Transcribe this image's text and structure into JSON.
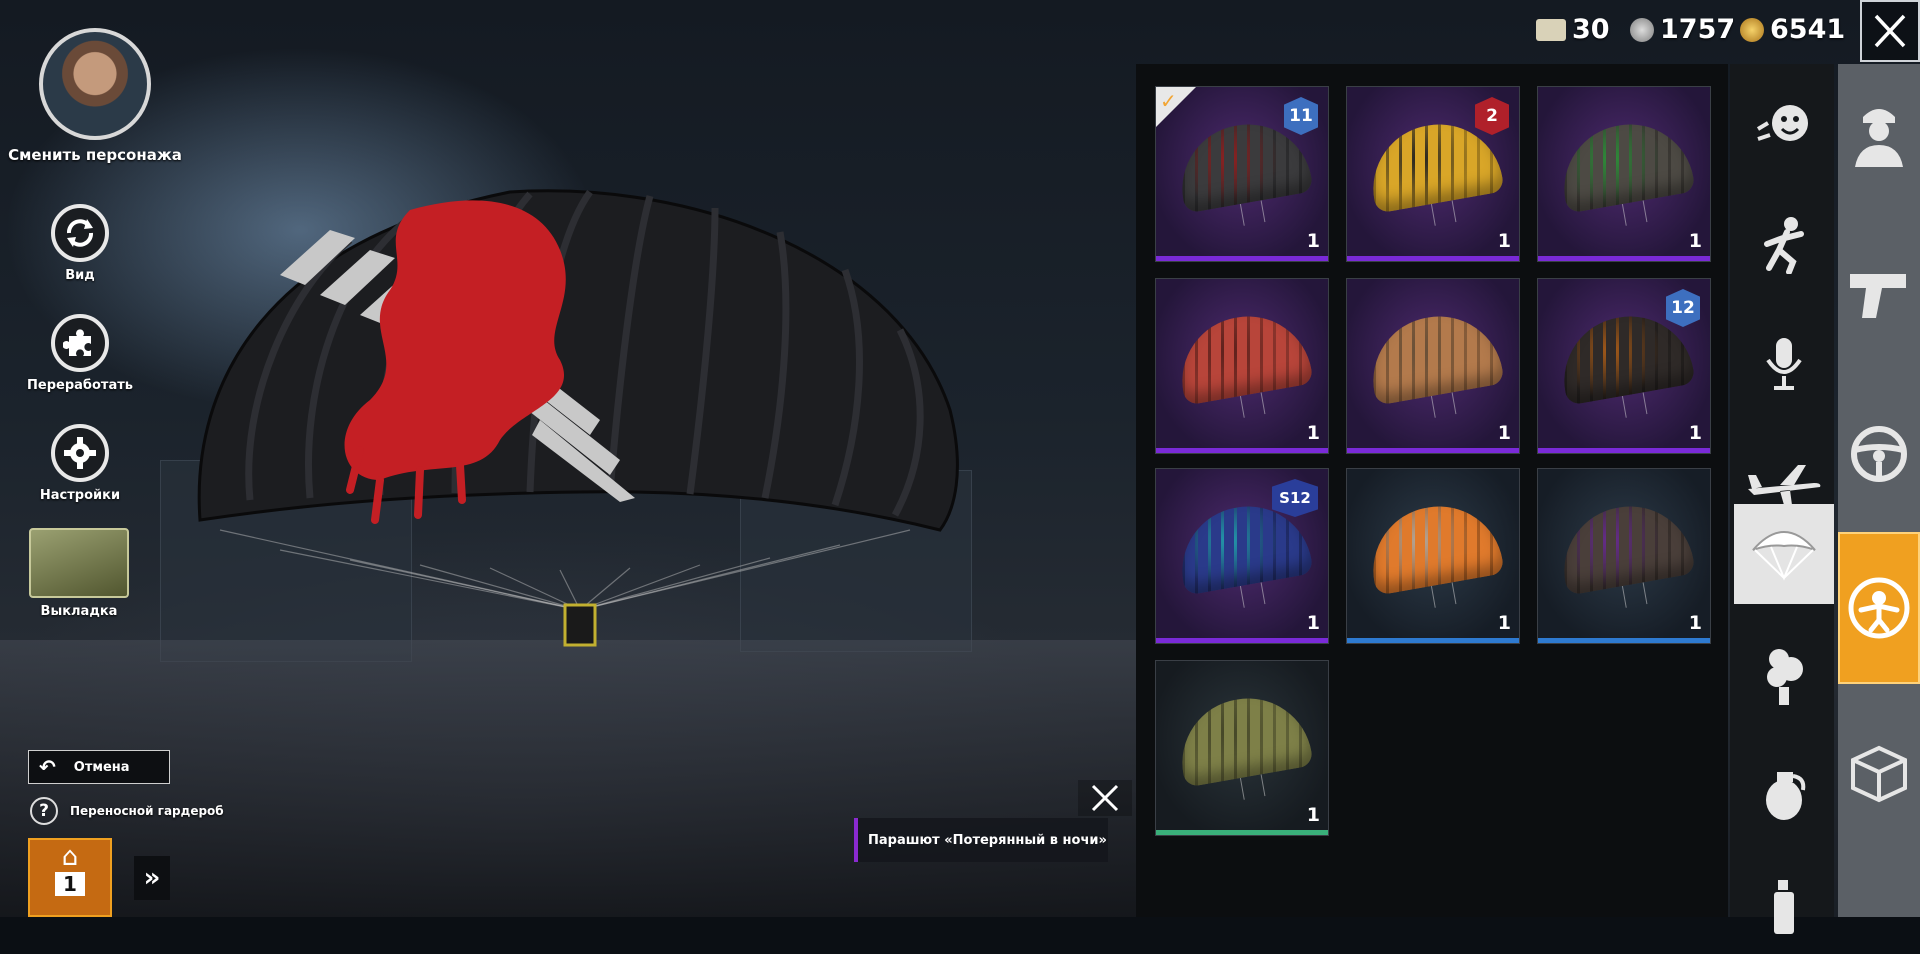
{
  "header": {
    "currencies": [
      {
        "name": "coupon-icon",
        "value": "30",
        "color": "#d9d2b8"
      },
      {
        "name": "silver-coin-icon",
        "value": "1757",
        "color": "#b8b8b8"
      },
      {
        "name": "gold-coin-icon",
        "value": "6541",
        "color": "#d9a22c"
      }
    ],
    "close_icon": "close-icon"
  },
  "left_menu": {
    "change_character": "Сменить персонажа",
    "view": "Вид",
    "recycle": "Переработать",
    "settings": "Настройки",
    "loadout": "Выкладка",
    "cancel": "Отмена",
    "portable_wardrobe": "Переносной гардероб",
    "wardrobe_slot": "1"
  },
  "tooltip": {
    "item_name": "Парашют «Потерянный в ночи»"
  },
  "inventory": {
    "items": [
      {
        "qty": "1",
        "rarity": "purple",
        "badge": "11",
        "equipped": true,
        "canopy": "#3b3b3d",
        "accent": "#c02a2a"
      },
      {
        "qty": "1",
        "rarity": "purple",
        "badge": "2",
        "equipped": false,
        "canopy": "#d9a628",
        "accent": "#2b2b2b"
      },
      {
        "qty": "1",
        "rarity": "purple",
        "badge": "",
        "equipped": false,
        "canopy": "#4d4a44",
        "accent": "#3cbf4c"
      },
      {
        "qty": "1",
        "rarity": "purple",
        "badge": "",
        "equipped": false,
        "canopy": "#b8453a",
        "accent": "#7a2a24"
      },
      {
        "qty": "1",
        "rarity": "purple",
        "badge": "",
        "equipped": false,
        "canopy": "#b37a4c",
        "accent": "#8a6a4a"
      },
      {
        "qty": "1",
        "rarity": "purple",
        "badge": "12",
        "equipped": false,
        "canopy": "#2f2a28",
        "accent": "#e07a20"
      },
      {
        "qty": "1",
        "rarity": "purple",
        "badge": "S12",
        "equipped": false,
        "canopy": "#2a3a8a",
        "accent": "#2fd0e8"
      },
      {
        "qty": "1",
        "rarity": "blue",
        "badge": "",
        "equipped": false,
        "canopy": "#e07a2c",
        "accent": "#f0e0d0"
      },
      {
        "qty": "1",
        "rarity": "blue",
        "badge": "",
        "equipped": false,
        "canopy": "#4a3f3a",
        "accent": "#8a3ac0"
      },
      {
        "qty": "1",
        "rarity": "green",
        "badge": "",
        "equipped": false,
        "canopy": "#7e8048",
        "accent": "#5a5c34"
      }
    ]
  },
  "tabs": [
    {
      "name": "emote-icon"
    },
    {
      "name": "pose-icon"
    },
    {
      "name": "voice-icon"
    },
    {
      "name": "plane-icon"
    },
    {
      "name": "parachute-icon",
      "active": true
    },
    {
      "name": "smoke-icon"
    },
    {
      "name": "grenade-icon"
    },
    {
      "name": "spray-icon"
    }
  ],
  "categories": [
    {
      "name": "character-icon"
    },
    {
      "name": "pistol-icon"
    },
    {
      "name": "steering-wheel-icon"
    },
    {
      "name": "skydiver-icon",
      "active": true
    },
    {
      "name": "box-icon"
    }
  ],
  "colors": {
    "rarity_purple": "#7a2ad8",
    "rarity_blue": "#2e7ad0",
    "rarity_green": "#3ab07a",
    "active_category": "#f0a020"
  }
}
